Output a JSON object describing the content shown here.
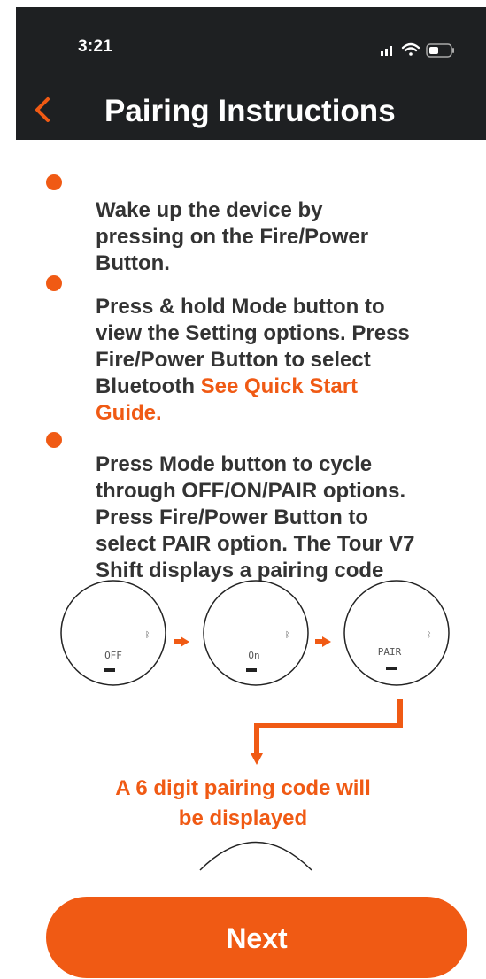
{
  "status_bar": {
    "time": "3:21"
  },
  "header": {
    "title": "Pairing Instructions"
  },
  "bullets": [
    {
      "text": "Wake up the device by\npressing on the Fire/Power\nButton.",
      "link": ""
    },
    {
      "text": "Press & hold Mode button to\nview the Setting options. Press\nFire/Power Button to select\nBluetooth ",
      "link": "See Quick Start\nGuide."
    },
    {
      "text": "Press Mode button to cycle\nthrough OFF/ON/PAIR options.\nPress Fire/Power Button to\nselect PAIR option. The Tour V7\nShift displays a pairing code",
      "link": ""
    }
  ],
  "screens": [
    {
      "label": "OFF"
    },
    {
      "label": "On"
    },
    {
      "label": "PAIR"
    }
  ],
  "pairing_note": "A 6 digit pairing code will\nbe displayed",
  "next_button": "Next",
  "colors": {
    "accent": "#f05a14",
    "header_bg": "#1e2022"
  }
}
